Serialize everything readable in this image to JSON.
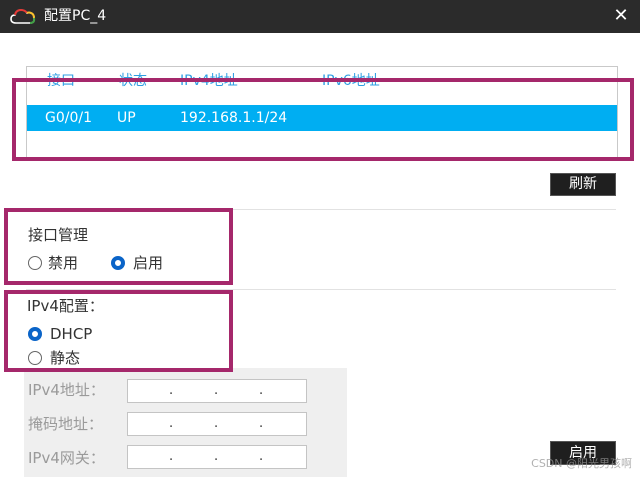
{
  "window": {
    "title": "配置PC_4",
    "close_symbol": "✕",
    "icon": "cloud-icon"
  },
  "interface_table": {
    "headers": [
      "接口",
      "状态",
      "IPv4地址",
      "IPv6地址"
    ],
    "rows": [
      {
        "interface": "G0/0/1",
        "status": "UP",
        "ipv4": "192.168.1.1/24",
        "ipv6": ""
      }
    ]
  },
  "refresh_button": "刷新",
  "interface_management": {
    "label": "接口管理",
    "options": [
      {
        "label": "禁用",
        "checked": false
      },
      {
        "label": "启用",
        "checked": true
      }
    ]
  },
  "ipv4_config": {
    "label": "IPv4配置：",
    "options": [
      {
        "label": "DHCP",
        "checked": true
      },
      {
        "label": "静态",
        "checked": false
      }
    ]
  },
  "static_fields": [
    {
      "label": "IPv4地址："
    },
    {
      "label": "掩码地址："
    },
    {
      "label": "IPv4网关："
    }
  ],
  "apply_button": "启用",
  "watermark": "CSDN @阳光男孩啊",
  "colors": {
    "titlebar": "#2b2b2b",
    "header_text": "#2f9fe3",
    "selected_row": "#00aef2",
    "radio_checked": "#0a64c8",
    "annotation_box": "#a5286b"
  }
}
